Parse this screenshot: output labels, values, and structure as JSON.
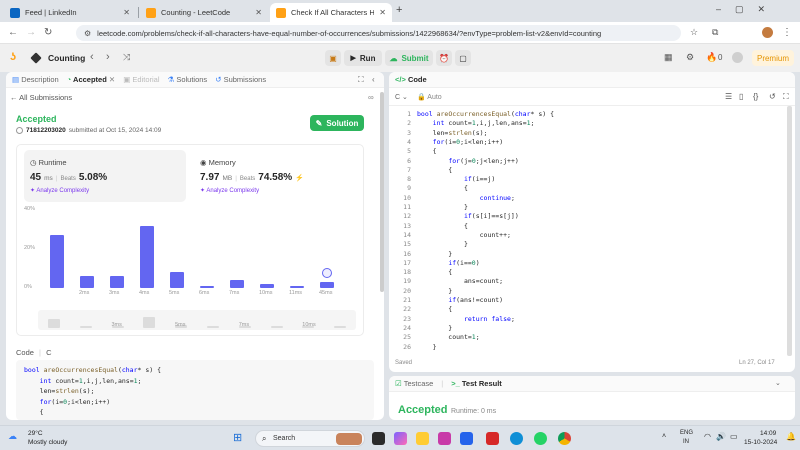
{
  "browser": {
    "tabs": [
      {
        "title": "Feed | LinkedIn",
        "color": "#0a66c2"
      },
      {
        "title": "Counting - LeetCode",
        "color": "#ffa116"
      },
      {
        "title": "Check If All Characters Have Eq",
        "color": "#ffa116"
      }
    ],
    "new_tab": "+",
    "url": "leetcode.com/problems/check-if-all-characters-have-equal-number-of-occurrences/submissions/1422968634/?envType=problem-list-v2&envId=counting"
  },
  "header": {
    "list_title": "Counting",
    "run_label": "Run",
    "submit_label": "Submit",
    "streak_count": "0",
    "premium_label": "Premium"
  },
  "left_panel": {
    "tabs": [
      "Description",
      "Accepted",
      "Editorial",
      "Solutions",
      "Submissions"
    ],
    "back_label": "All Submissions",
    "status": "Accepted",
    "user": "71812203020",
    "submitted_text": "submitted at Oct 15, 2024 14:09",
    "solution_button": "Solution",
    "runtime": {
      "label": "Runtime",
      "value": "45",
      "unit": "ms",
      "beats_label": "Beats",
      "beats": "5.08%",
      "analyze": "Analyze Complexity"
    },
    "memory": {
      "label": "Memory",
      "value": "7.97",
      "unit": "MB",
      "beats_label": "Beats",
      "beats": "74.58%",
      "analyze": "Analyze Complexity"
    },
    "code_label": "Code",
    "code_lang": "C",
    "code_preview": [
      "bool areOccurrencesEqual(char* s) {",
      "    int count=1,i,j,len,ans=1;",
      "    len=strlen(s);",
      "    for(i=0;i<len;i++)",
      "    {"
    ]
  },
  "chart_data": {
    "type": "bar",
    "y_ticks": [
      "40%",
      "20%",
      "0%"
    ],
    "ylim": [
      0,
      40
    ],
    "categories": [
      "",
      "2ms",
      "3ms",
      "4ms",
      "5ms",
      "6ms",
      "7ms",
      "10ms",
      "11ms",
      "45ms"
    ],
    "values": [
      27,
      6,
      6,
      32,
      8,
      1,
      4,
      2,
      1,
      3
    ],
    "highlight_index": 9,
    "minimap_labels": [
      "3ms",
      "5ms",
      "7ms",
      "10ms"
    ]
  },
  "right_panel": {
    "title": "Code",
    "lang": "C",
    "auto": "Auto",
    "saved": "Saved",
    "cursor": "Ln 27, Col 17",
    "line_numbers": [
      "1",
      "2",
      "3",
      "4",
      "5",
      "6",
      "7",
      "8",
      "9",
      "10",
      "11",
      "12",
      "13",
      "14",
      "15",
      "16",
      "17",
      "18",
      "19",
      "20",
      "21",
      "22",
      "23",
      "24",
      "25",
      "26"
    ],
    "code": [
      "bool areOccurrencesEqual(char* s) {",
      "    int count=1,i,j,len,ans=1;",
      "    len=strlen(s);",
      "    for(i=0;i<len;i++)",
      "    {",
      "        for(j=0;j<len;j++)",
      "        {",
      "            if(i==j)",
      "            {",
      "                continue;",
      "            }",
      "            if(s[i]==s[j])",
      "            {",
      "                count++;",
      "            }",
      "        }",
      "        if(i==0)",
      "        {",
      "            ans=count;",
      "        }",
      "        if(ans!=count)",
      "        {",
      "            return false;",
      "        }",
      "        count=1;",
      "    }"
    ]
  },
  "bottom_panel": {
    "tabs": [
      "Testcase",
      "Test Result"
    ],
    "status": "Accepted",
    "runtime_text": "Runtime: 0 ms"
  },
  "taskbar": {
    "temp": "29°C",
    "weather": "Mostly cloudy",
    "search_placeholder": "Search",
    "lang1": "ENG",
    "lang2": "IN",
    "time": "14:09",
    "date": "15-10-2024"
  }
}
